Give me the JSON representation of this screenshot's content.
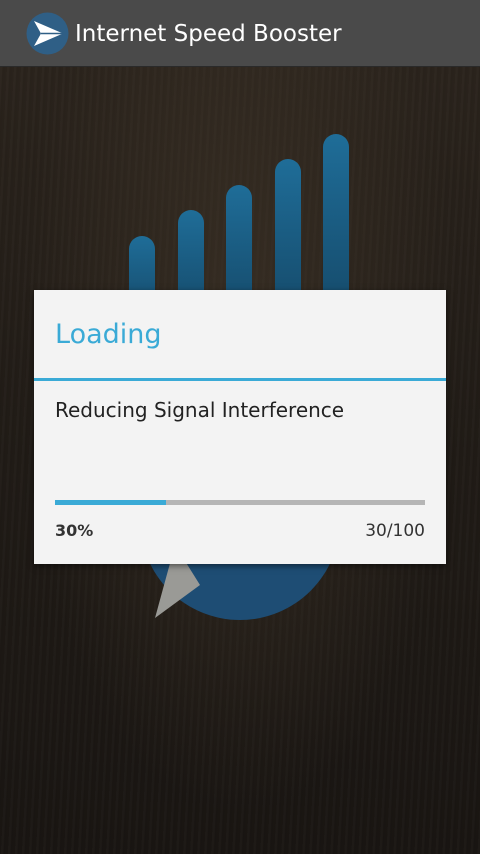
{
  "app_bar": {
    "title": "Internet Speed Booster",
    "icon": "paper-plane-icon"
  },
  "background": {
    "logo": "signal-bars-icon"
  },
  "dialog": {
    "title": "Loading",
    "message": "Reducing Signal Interference",
    "progress": {
      "value": 30,
      "max": 100,
      "fraction": 0.3,
      "percent_label": "30%",
      "count_label": "30/100"
    }
  },
  "colors": {
    "accent": "#3aaad6",
    "action_bar": "#4a4a4a",
    "dialog_bg": "#f3f3f3",
    "logo_blue": "#1f5f84"
  }
}
